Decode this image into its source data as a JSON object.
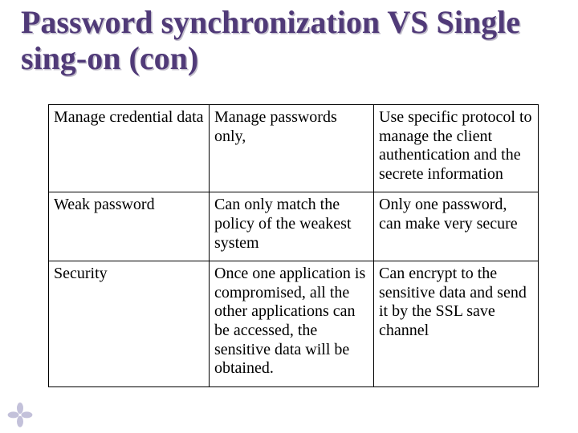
{
  "title": "Password synchronization VS Single sing-on (con)",
  "table": {
    "rows": [
      {
        "c1": "Manage credential data",
        "c2": "Manage passwords only,",
        "c3": "Use specific protocol to manage the client authentication and the secrete information"
      },
      {
        "c1": "Weak password",
        "c2": "Can only match the policy of the weakest system",
        "c3": "Only one password, can make very secure"
      },
      {
        "c1": "Security",
        "c2": "Once one application is compromised, all the other applications can be accessed, the sensitive data will be obtained.",
        "c3": "Can encrypt to the sensitive data and send it by the SSL save channel"
      }
    ]
  }
}
